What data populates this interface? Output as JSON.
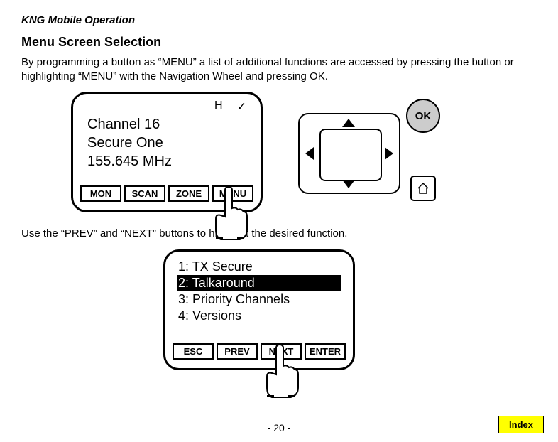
{
  "header": "KNG Mobile Operation",
  "section_title": "Menu Screen Selection",
  "intro": "By programming a button as “MENU” a list of additional functions are accessed by pressing the button or highlighting “MENU” with the Navigation Wheel and pressing OK.",
  "radio": {
    "status_h": "H",
    "status_check": "✓",
    "channel": "Channel 16",
    "name": "Secure One",
    "freq": "155.645 MHz",
    "softkeys": [
      "MON",
      "SCAN",
      "ZONE",
      "MENU"
    ]
  },
  "nav": {
    "ok": "OK"
  },
  "mid_text": "Use the “PREV” and “NEXT” buttons to highlight the desired function.",
  "menu": {
    "items": [
      {
        "label": "1: TX Secure",
        "selected": false
      },
      {
        "label": "2: Talkaround",
        "selected": true
      },
      {
        "label": "3: Priority Channels",
        "selected": false
      },
      {
        "label": "4: Versions",
        "selected": false
      }
    ],
    "softkeys": [
      "ESC",
      "PREV",
      "NEXT",
      "ENTER"
    ]
  },
  "footer": {
    "page": "- 20 -",
    "index": "Index"
  }
}
